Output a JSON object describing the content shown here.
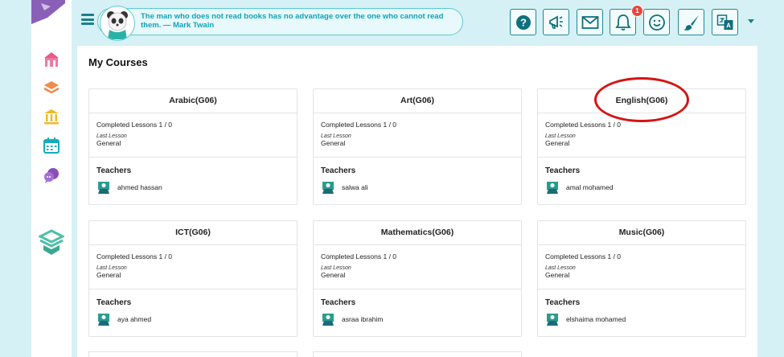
{
  "header": {
    "quote": "The man who does not read books has no advantage over the one who cannot read them. — Mark Twain",
    "notifications_count": "1"
  },
  "page_title": "My Courses",
  "labels": {
    "teachers": "Teachers",
    "last_lesson": "Last Lesson"
  },
  "courses": [
    {
      "title": "Arabic(G06)",
      "completed": "Completed Lessons 1 / 0",
      "last_lesson": "General",
      "teacher": "ahmed hassan"
    },
    {
      "title": "Art(G06)",
      "completed": "Completed Lessons 1 / 0",
      "last_lesson": "General",
      "teacher": "salwa ali"
    },
    {
      "title": "English(G06)",
      "completed": "Completed Lessons 1 / 0",
      "last_lesson": "General",
      "teacher": "amal mohamed"
    },
    {
      "title": "ICT(G06)",
      "completed": "Completed Lessons 1 / 0",
      "last_lesson": "General",
      "teacher": "aya ahmed"
    },
    {
      "title": "Mathematics(G06)",
      "completed": "Completed Lessons 1 / 0",
      "last_lesson": "General",
      "teacher": "asraa ibrahim"
    },
    {
      "title": "Music(G06)",
      "completed": "Completed Lessons 1 / 0",
      "last_lesson": "General",
      "teacher": "elshaima mohamed"
    }
  ],
  "colors": {
    "accent": "#1a8a98",
    "highlight": "#d41414",
    "badge": "#e8453c"
  }
}
